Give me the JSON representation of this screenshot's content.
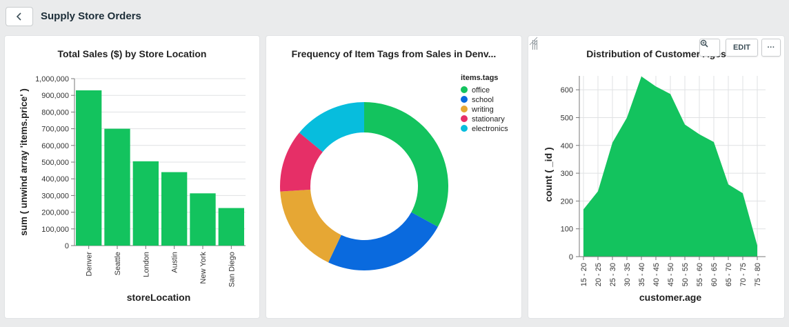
{
  "header": {
    "title": "Supply Store Orders",
    "back_icon": "chevron-left-icon"
  },
  "card_tools": {
    "zoom_icon": "zoom-icon",
    "edit_label": "EDIT",
    "more_label": "···"
  },
  "charts": [
    {
      "title": "Total Sales ($) by Store Location",
      "xlabel": "storeLocation",
      "ylabel": "sum ( unwind array 'items.price' )",
      "yticks": [
        "0",
        "100,000",
        "200,000",
        "300,000",
        "400,000",
        "500,000",
        "600,000",
        "700,000",
        "800,000",
        "900,000",
        "1,000,000"
      ]
    },
    {
      "title": "Frequency of Item Tags from Sales in Denv...",
      "legend_title": "items.tags"
    },
    {
      "title": "Distribution of Customer Ages",
      "xlabel": "customer.age",
      "ylabel": "count ( _id )",
      "yticks": [
        "0",
        "100",
        "200",
        "300",
        "400",
        "500",
        "600"
      ]
    }
  ],
  "colors": {
    "bar": "#13c35e",
    "area": "#13c35e",
    "grid": "#dfe1e3",
    "office": "#13c35e",
    "school": "#0a6ade",
    "writing": "#e6a734",
    "stationary": "#e62f67",
    "electronics": "#07bddd"
  },
  "chart_data": [
    {
      "type": "bar",
      "title": "Total Sales ($) by Store Location",
      "categories": [
        "Denver",
        "Seattle",
        "London",
        "Austin",
        "New York",
        "San Diego"
      ],
      "values": [
        930000,
        700000,
        505000,
        440000,
        313000,
        225000
      ],
      "xlabel": "storeLocation",
      "ylabel": "sum ( unwind array 'items.price' )",
      "ylim": [
        0,
        1000000
      ],
      "grid": true
    },
    {
      "type": "pie",
      "title": "Frequency of Item Tags from Sales in Denv...",
      "legend_title": "items.tags",
      "legend_position": "top-right",
      "categories": [
        "office",
        "school",
        "writing",
        "stationary",
        "electronics"
      ],
      "values": [
        33,
        24,
        17,
        12,
        14
      ]
    },
    {
      "type": "area",
      "title": "Distribution of Customer Ages",
      "categories": [
        "15 - 20",
        "20 - 25",
        "25 - 30",
        "30 - 35",
        "35 - 40",
        "40 - 45",
        "45 - 50",
        "50 - 55",
        "55 - 60",
        "60 - 65",
        "65 - 70",
        "70 - 75",
        "75 - 80"
      ],
      "values": [
        170,
        235,
        410,
        500,
        648,
        612,
        585,
        475,
        440,
        412,
        260,
        228,
        40
      ],
      "xlabel": "customer.age",
      "ylabel": "count ( _id )",
      "ylim": [
        0,
        650
      ],
      "grid": true
    }
  ]
}
